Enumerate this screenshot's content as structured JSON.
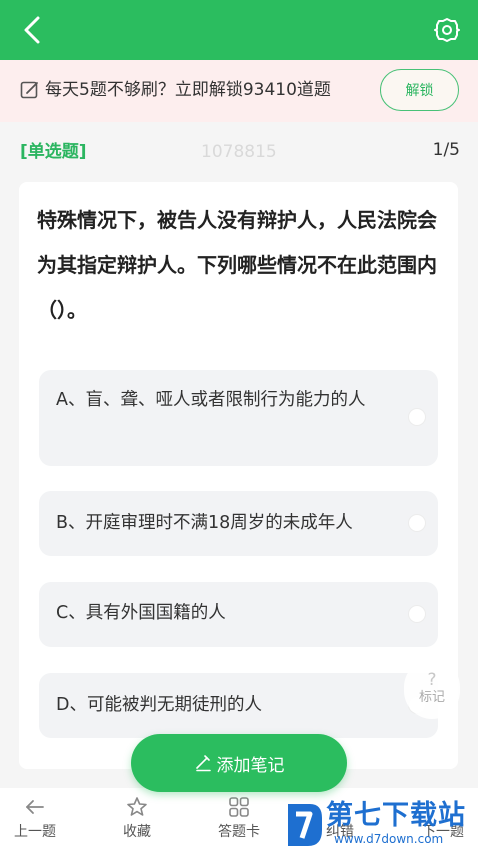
{
  "banner": {
    "text": "每天5题不够刷？立即解锁93410道题",
    "unlock_label": "解锁"
  },
  "question": {
    "type_label": "[单选题]",
    "id": "1078815",
    "progress": "1/5",
    "stem": "特殊情况下，被告人没有辩护人，人民法院会为其指定辩护人。下列哪些情况不在此范围内（）。",
    "options": [
      "A、盲、聋、哑人或者限制行为能力的人",
      "B、开庭审理时不满18周岁的未成年人",
      "C、具有外国国籍的人",
      "D、可能被判无期徒刑的人"
    ]
  },
  "mark": {
    "glyph": "?",
    "label": "标记"
  },
  "note_button": {
    "label": "添加笔记"
  },
  "bottom_nav": {
    "prev": "上一题",
    "favorite": "收藏",
    "answer_card": "答题卡",
    "error_partial": "纠错",
    "next_partial": "下一题"
  },
  "watermark": {
    "title": "第七下载站",
    "url": "www.d7down.com"
  },
  "colors": {
    "primary": "#2bbd5f",
    "banner_bg": "#fdeeee",
    "watermark": "#1e6fd0"
  },
  "icons": {
    "back": "chevron-left-icon",
    "settings": "gear-icon",
    "banner": "edit-icon",
    "note": "pencil-icon",
    "prev": "arrow-left-icon",
    "favorite": "star-icon",
    "answer_card": "grid-icon"
  }
}
